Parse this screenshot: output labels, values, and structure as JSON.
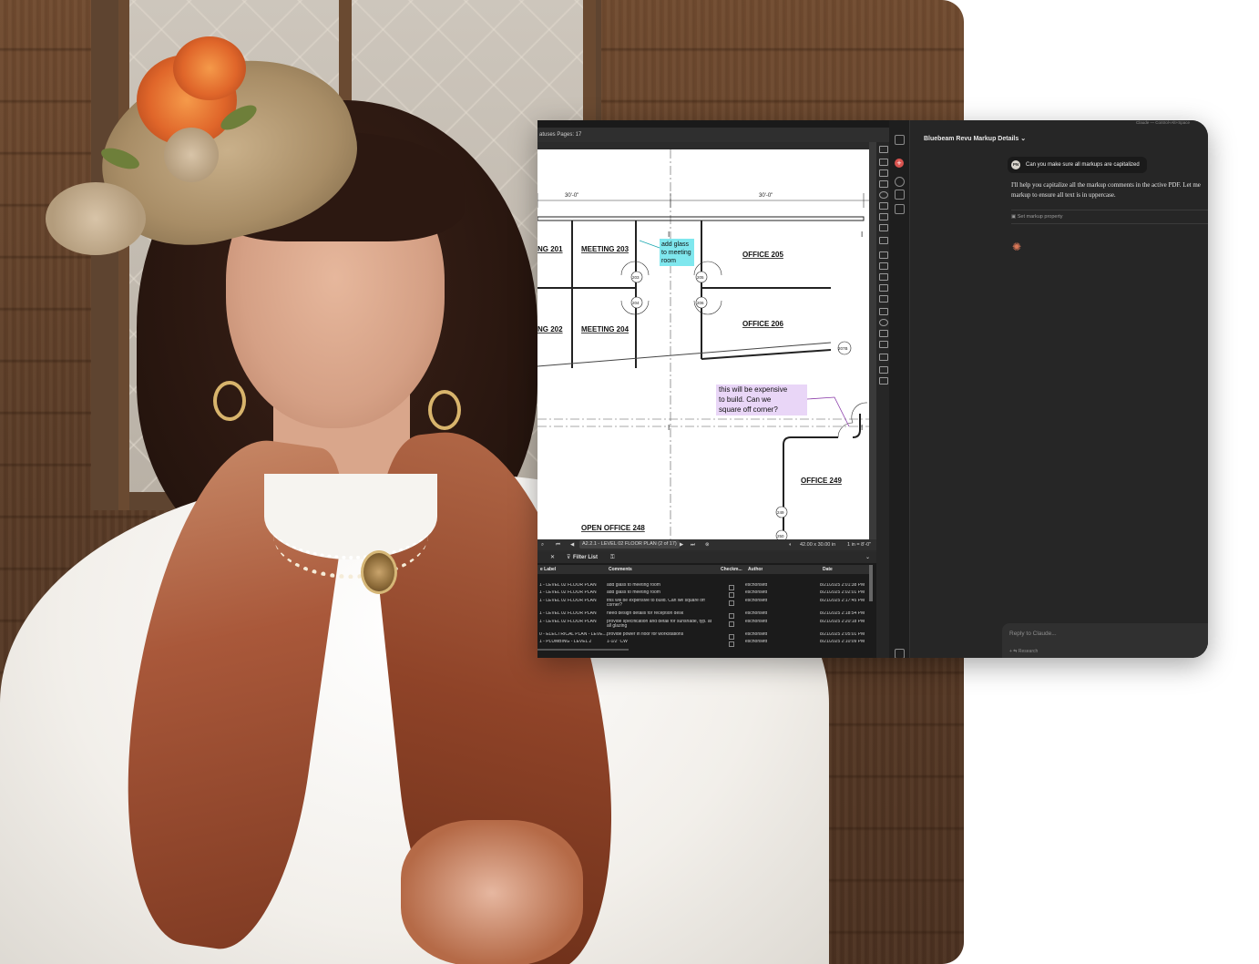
{
  "pdf": {
    "subbar_text": "atuses  Pages: 17",
    "rooms": {
      "r201": "NG  201",
      "r203": "MEETING  203",
      "r205": "OFFICE  205",
      "r202": "NG  202",
      "r204": "MEETING  204",
      "r206": "OFFICE  206",
      "r249": "OFFICE  249",
      "r248": "OPEN OFFICE  248"
    },
    "door_tags": [
      "203",
      "204",
      "205",
      "206",
      "207B",
      "249",
      "250"
    ],
    "dims": [
      "30'-0\"",
      "30'-0\""
    ],
    "note_cyan": "add glass to meeting room",
    "note_purple": "this will be expensive to build. Can we square off corner?",
    "status": {
      "sheet": "A2.2.1 - LEVEL 02 FLOOR PLAN (2 of 17)",
      "size": "42.00 x 30.00 in",
      "scale": "1 in = 8'-0\""
    }
  },
  "markups_list": {
    "filter_label": "Filter List",
    "columns": [
      "e Label",
      "Comments",
      "Checkm...",
      "Author",
      "Date"
    ],
    "rows": [
      {
        "label": "1 - LEVEL 02 FLOOR PLAN",
        "comment": "add glass to meeting room",
        "author": "eschonsett",
        "date": "8/21/2025 2:01:38 PM"
      },
      {
        "label": "1 - LEVEL 02 FLOOR PLAN",
        "comment": "add glass to meeting room",
        "author": "eschonsett",
        "date": "8/21/2025 2:02:01 PM"
      },
      {
        "label": "1 - LEVEL 02 FLOOR PLAN",
        "comment": "this will be expensive to build. Can we square off corner?",
        "author": "eschonsett",
        "date": "8/21/2025 2:17:45 PM"
      },
      {
        "label": "1 - LEVEL 02 FLOOR PLAN",
        "comment": "need design details for reception desk",
        "author": "eschonsett",
        "date": "8/21/2025 2:18:54 PM"
      },
      {
        "label": "1 - LEVEL 02 FLOOR PLAN",
        "comment": "provide specification and detail for sunshade, typ. at all glazing",
        "author": "eschonsett",
        "date": "8/21/2025 2:20:18 PM"
      },
      {
        "label": "0 - ELECTRICAL PLAN - LEVE...",
        "comment": "provide power in floor for workstations",
        "author": "eschonsett",
        "date": "8/21/2025 2:05:01 PM"
      },
      {
        "label": "1 - PLUMBING - LEVEL 2",
        "comment": "1-1/2\" CW",
        "author": "eschonsett",
        "date": "8/21/2025 2:10:09 PM"
      }
    ]
  },
  "chat": {
    "top_hint": "Claude — Control+Alt+Space",
    "title": "Bluebeam Revu Markup Details",
    "user_initials": "PN",
    "user_message": "Can you make sure all markups are capitalized",
    "assistant_text": "I'll help you capitalize all the markup comments in the active PDF. Let me markup to ensure all text is in uppercase.",
    "tool_label": "Set markup property",
    "reply_placeholder": "Reply to Claude...",
    "reply_tools": "+   ⇆   Research"
  },
  "colors": {
    "accent": "#d97757",
    "cyan_note": "#7fe7ee",
    "purple_note": "#e9d6f7"
  }
}
